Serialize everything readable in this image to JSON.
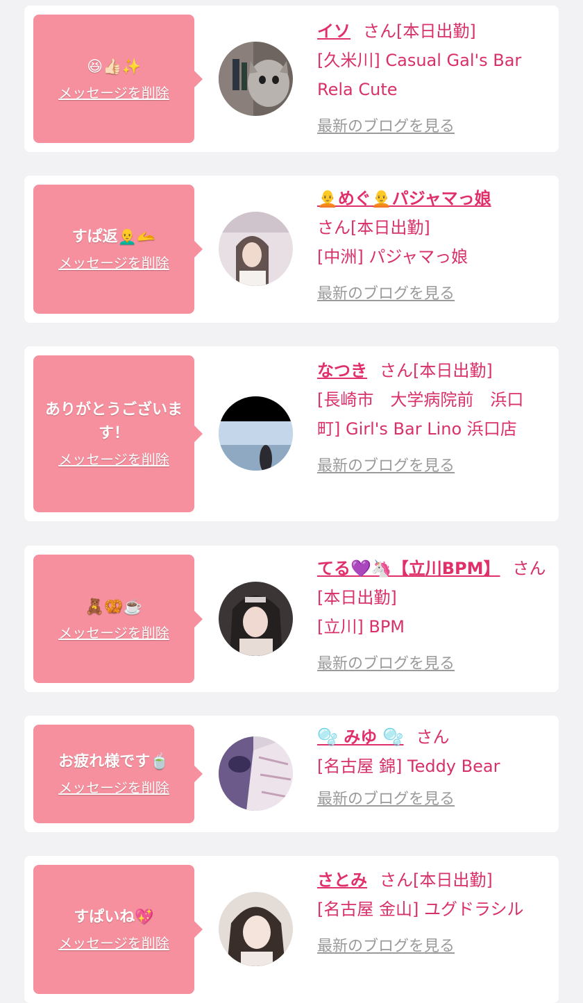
{
  "delete_label": "メッセージを削除",
  "blog_label": "最新のブログを見る",
  "san_label": "さん",
  "cards": [
    {
      "message": "😆👍🏻✨",
      "name": "イソ",
      "status": "[本日出勤]",
      "shop": "[久米川] Casual Gal's Bar Rela Cute"
    },
    {
      "message": "すぱ返👨‍🦲🫴",
      "name": "🧑‍🦲めぐ🧑‍🦲パジャマっ娘",
      "status": "[本日出勤]",
      "shop": "[中洲] パジャマっ娘"
    },
    {
      "message": "ありがとうございます！",
      "name": "なつき",
      "status": "[本日出勤]",
      "shop": "[長崎市　大学病院前　浜口町] Girl's Bar Lino 浜口店"
    },
    {
      "message": "🧸🥨☕️",
      "name": "てる💜🦄【立川BPM】",
      "status": "[本日出勤]",
      "shop": "[立川] BPM"
    },
    {
      "message": "お疲れ様です🍵",
      "name": "🫧 みゆ 🫧",
      "status": "",
      "shop": "[名古屋 錦] Teddy Bear"
    },
    {
      "message": "すぱいね💖",
      "name": "さとみ",
      "status": "[本日出勤]",
      "shop": "[名古屋 金山] ユグドラシル"
    }
  ],
  "colors": {
    "bubble": "#f7909e",
    "accent": "#e0306a",
    "muted": "#9a9a9a"
  }
}
